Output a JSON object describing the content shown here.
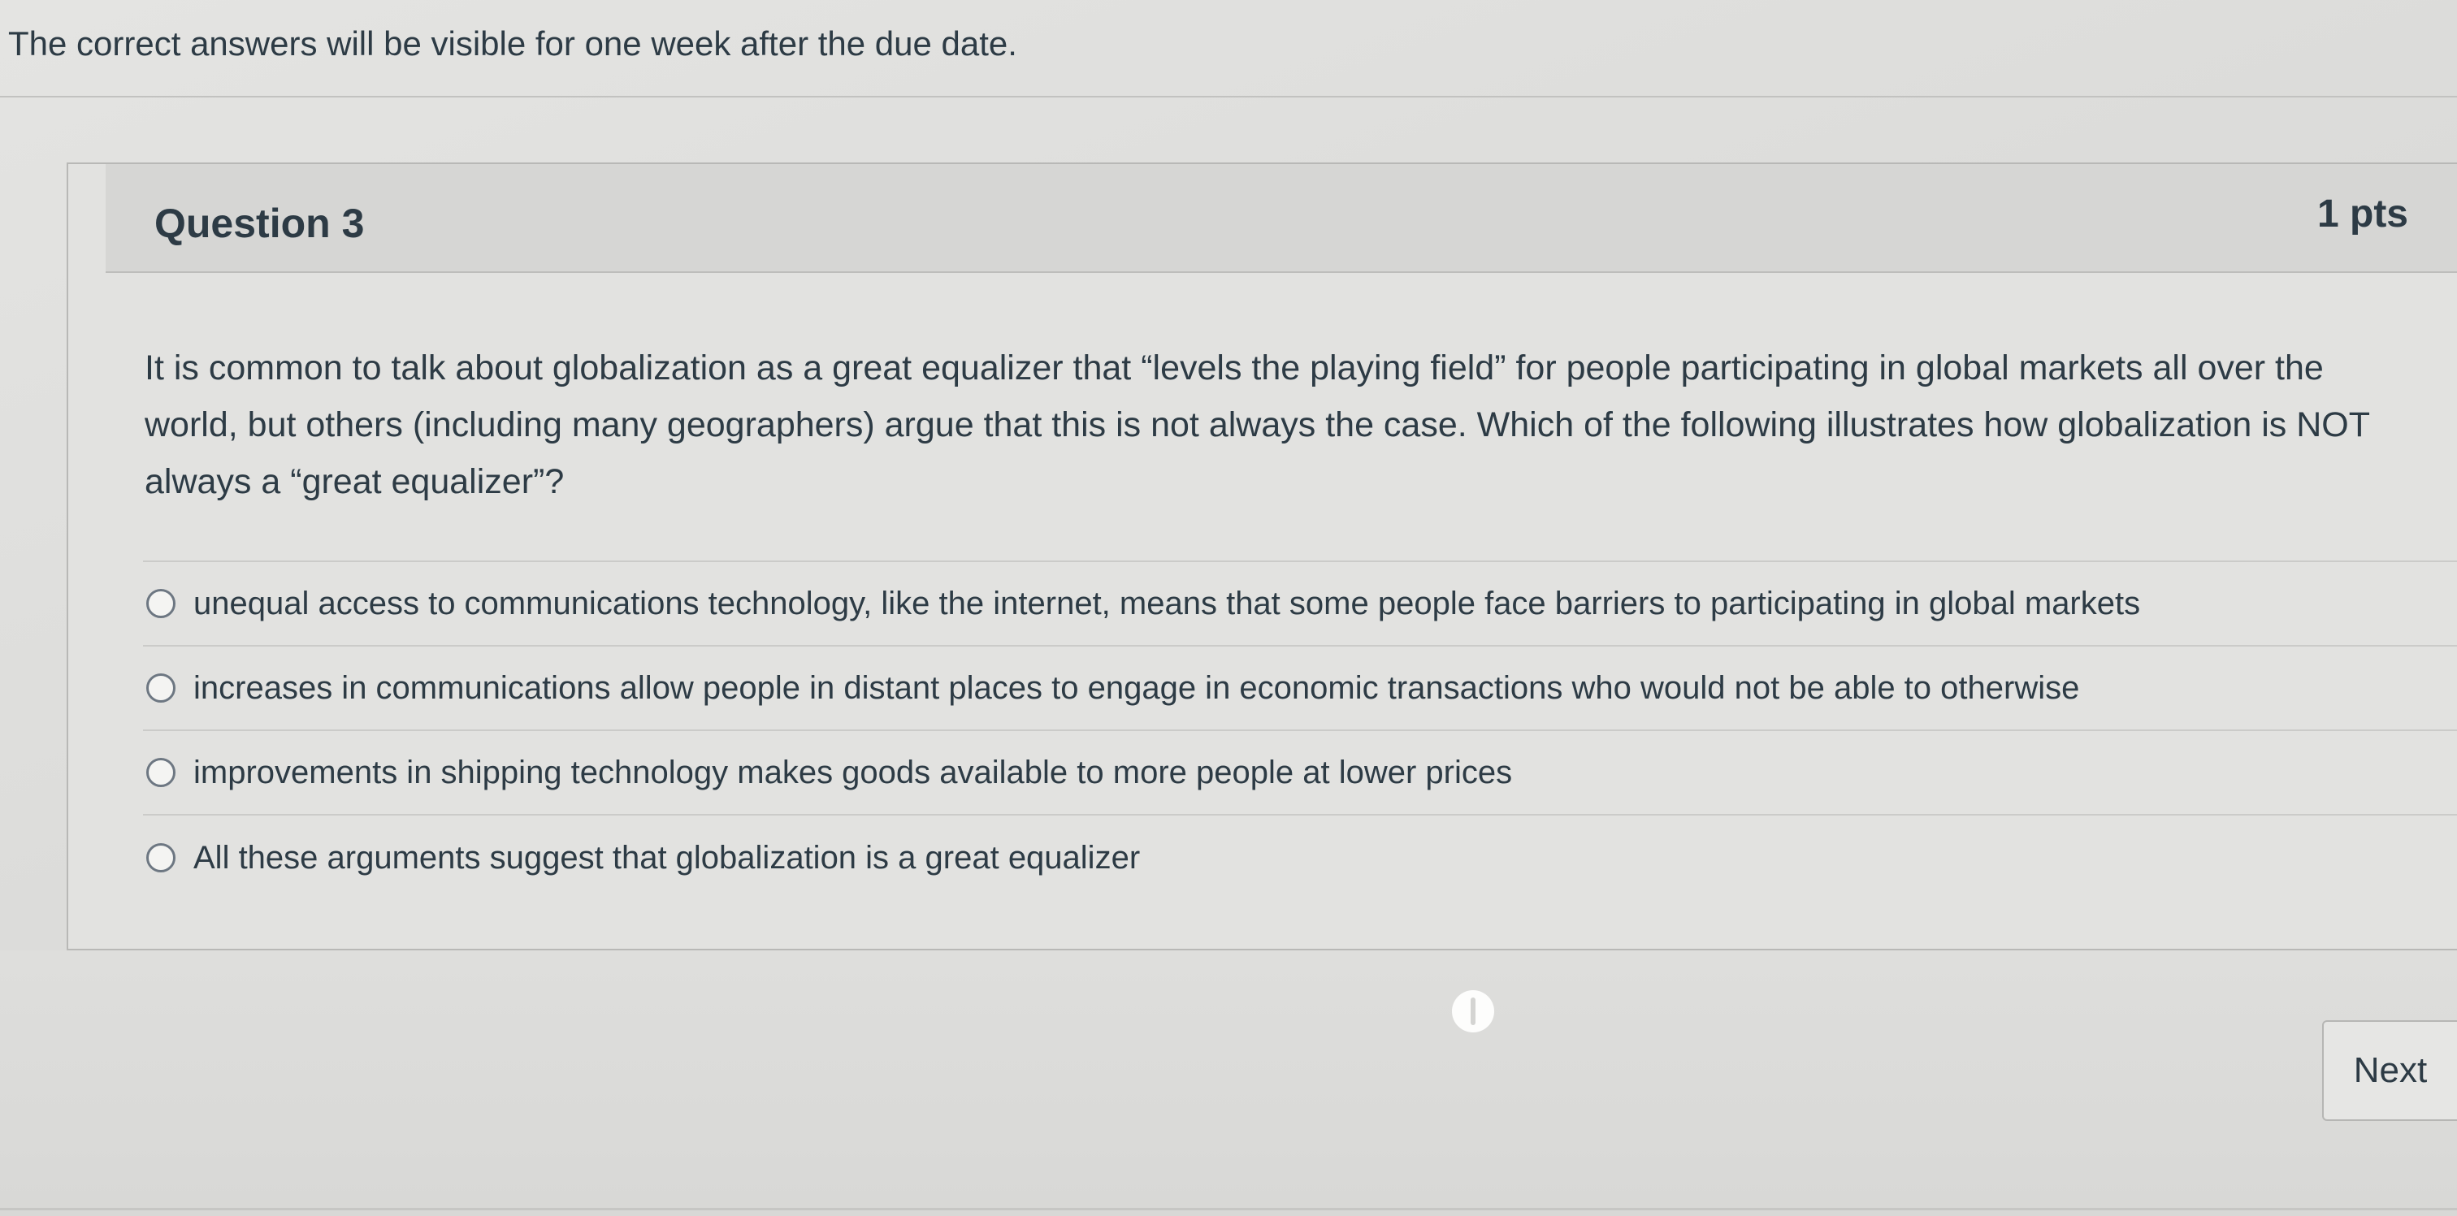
{
  "notice": "The correct answers will be visible for one week after the due date.",
  "question": {
    "title": "Question 3",
    "points": "1 pts",
    "text": "It is common to talk about globalization as a great equalizer that “levels the playing field” for people participating in global markets all over the world, but others (including many geographers) argue that this is not always the case. Which of the following illustrates how globalization is NOT always a “great equalizer”?",
    "answers": [
      "unequal access to communications technology, like the internet, means that some people face barriers to participating in global markets",
      "increases in communications allow people in distant places to engage in economic transactions who would not be able to otherwise",
      "improvements in shipping technology makes goods available to more people at lower prices",
      "All these arguments suggest that globalization is a great equalizer"
    ]
  },
  "navigation": {
    "next_label": "Next"
  },
  "icons": {
    "radio": "radio-unselected-icon",
    "cursor": "pointer-cursor-icon"
  }
}
